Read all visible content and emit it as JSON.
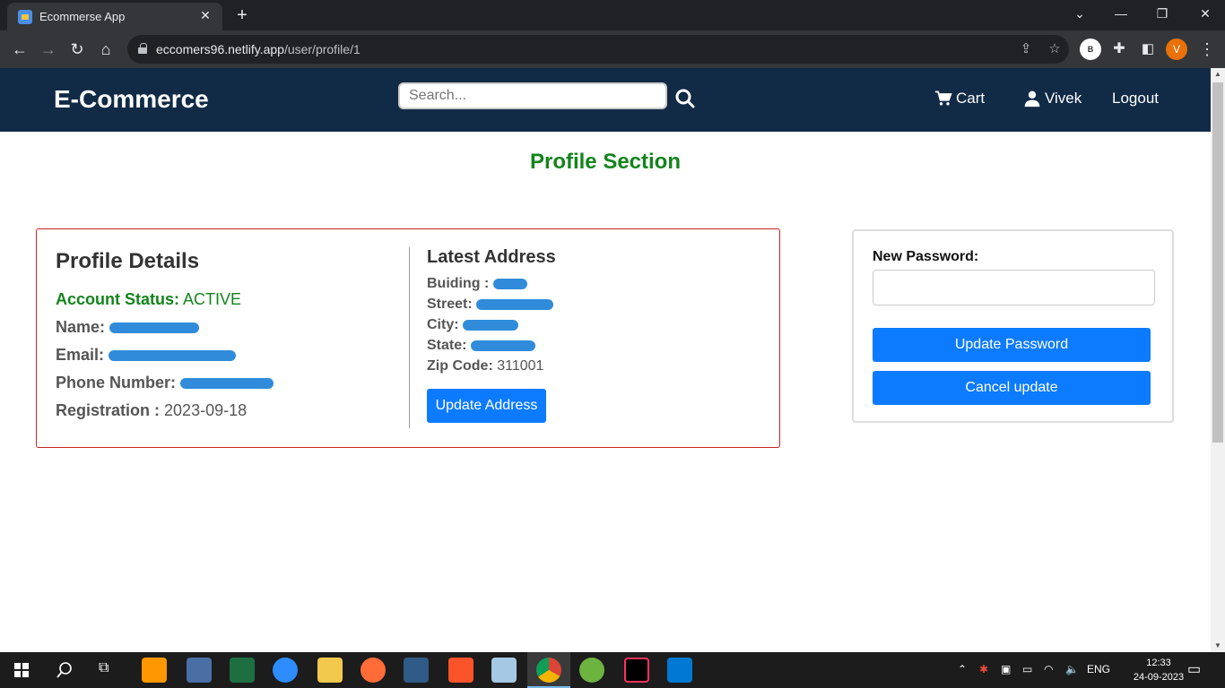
{
  "browser": {
    "tab_title": "Ecommerse App",
    "url_host": "eccomers96.netlify.app",
    "url_path": "/user/profile/1",
    "profile_b": "B",
    "profile_v": "V"
  },
  "site": {
    "brand": "E-Commerce",
    "search_placeholder": "Search...",
    "nav": {
      "cart": "Cart",
      "user": "Vivek",
      "logout": "Logout"
    }
  },
  "page": {
    "title": "Profile Section",
    "title_color": "#13841c"
  },
  "profile": {
    "heading": "Profile Details",
    "status_label": "Account Status:",
    "status_value": "ACTIVE",
    "name_label": "Name:",
    "email_label": "Email:",
    "phone_label": "Phone Number:",
    "registration_label": "Registration :",
    "registration_value": "2023-09-18"
  },
  "address": {
    "heading": "Latest Address",
    "building_label": "Buiding :",
    "street_label": "Street:",
    "city_label": "City:",
    "state_label": "State:",
    "zip_label": "Zip Code:",
    "zip_value": "311001",
    "update_button": "Update Address"
  },
  "password": {
    "label": "New Password:",
    "value": "",
    "update_button": "Update Password",
    "cancel_button": "Cancel update"
  },
  "taskbar": {
    "language": "ENG",
    "time": "12:33",
    "date": "24-09-2023"
  },
  "colors": {
    "header_bg": "#112a46",
    "primary_button": "#0d7bff",
    "profile_border": "#cc2222"
  }
}
